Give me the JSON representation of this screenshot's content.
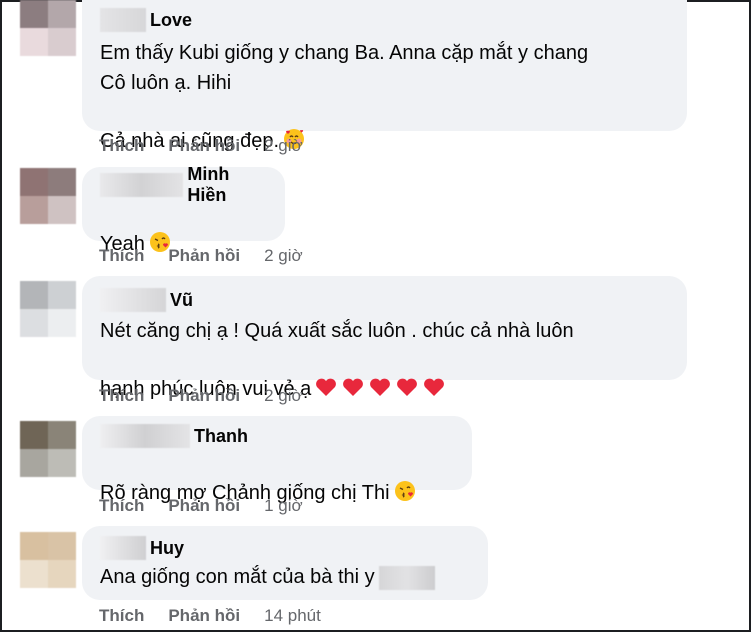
{
  "frame_color": "#1c1e21",
  "bubble_color": "#f0f2f5",
  "muted_color": "#65676b",
  "comments": [
    {
      "author": "Love",
      "text": "Em thấy Kubi giống y chang Ba. Anna cặp mắt y chang\nCô luôn ạ. Hihi\nCả nhà ai cũng đẹp.",
      "emoji": "smiling-face-with-hearts",
      "like_label": "Thích",
      "reply_label": "Phản hồi",
      "time": "2 giờ"
    },
    {
      "author": "Minh Hiền",
      "text": "Yeah",
      "emoji": "face-blowing-kiss",
      "like_label": "Thích",
      "reply_label": "Phản hồi",
      "time": "2 giờ"
    },
    {
      "author": "Vũ",
      "text": "Nét căng chị ạ ! Quá xuất sắc luôn . chúc cả nhà luôn\nhạnh phúc luôn vui vẻ ạ",
      "emoji": "red-hearts-x5",
      "like_label": "Thích",
      "reply_label": "Phản hồi",
      "time": "2 giờ"
    },
    {
      "author": "Thanh",
      "text": "Rõ ràng mợ Chảnh giống chị Thi",
      "emoji": "face-blowing-kiss",
      "like_label": "Thích",
      "reply_label": "Phản hồi",
      "time": "1 giờ"
    },
    {
      "author": "Huy",
      "text": "Ana giống con mắt của bà thi y",
      "emoji": "",
      "like_label": "Thích",
      "reply_label": "Phản hồi",
      "time": "14 phút"
    }
  ]
}
